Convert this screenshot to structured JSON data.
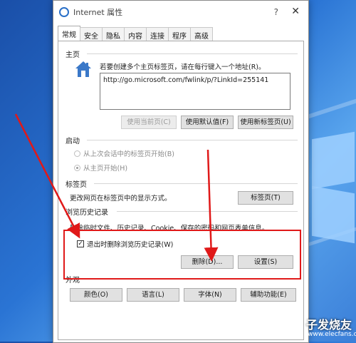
{
  "window": {
    "title": "Internet 属性",
    "help": "?",
    "close": "✕"
  },
  "tabs": [
    "常规",
    "安全",
    "隐私",
    "内容",
    "连接",
    "程序",
    "高级"
  ],
  "home": {
    "group": "主页",
    "hint": "若要创建多个主页标签页，请在每行键入一个地址(R)。",
    "url": "http://go.microsoft.com/fwlink/p/?LinkId=255141",
    "btn_current": "使用当前页(C)",
    "btn_default": "使用默认值(F)",
    "btn_newtab": "使用新标签页(U)"
  },
  "startup": {
    "group": "启动",
    "option1": "从上次会话中的标签页开始(B)",
    "option2": "从主页开始(H)"
  },
  "tabsgroup": {
    "group": "标签页",
    "desc": "更改网页在标签页中的显示方式。",
    "btn": "标签页(T)"
  },
  "history": {
    "group": "浏览历史记录",
    "desc": "删除临时文件、历史记录、Cookie、保存的密码和网页表单信息。",
    "checkbox": "退出时删除浏览历史记录(W)",
    "btn_delete": "删除(D)...",
    "btn_settings": "设置(S)"
  },
  "appearance": {
    "group": "外观",
    "btn_colors": "颜色(O)",
    "btn_languages": "语言(L)",
    "btn_fonts": "字体(N)",
    "btn_accessibility": "辅助功能(E)"
  },
  "watermark": {
    "text": "子发烧友",
    "url": "www.elecfans.com"
  },
  "colors": {
    "annotation": "#e01919",
    "desktop": "#2a74d4"
  }
}
